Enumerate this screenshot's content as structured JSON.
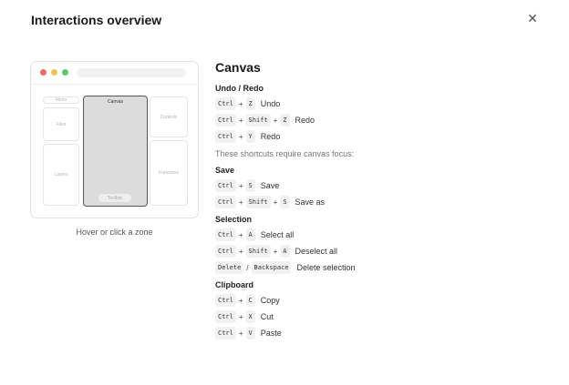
{
  "dialog": {
    "title": "Interactions overview",
    "close_icon": "close-icon"
  },
  "preview": {
    "zones": {
      "menu": "Menu",
      "files": "Files",
      "layers": "Layers",
      "canvas": "Canvas",
      "controls": "Controls",
      "functions": "Functions",
      "toolbar": "Toolbar"
    },
    "hint": "Hover or click a zone",
    "colors": {
      "red": "#ef6b6b",
      "yellow": "#f2c24f",
      "green": "#5ccb6b"
    }
  },
  "panel": {
    "title": "Canvas",
    "groups": [
      {
        "title": "Undo / Redo",
        "rows": [
          {
            "keys": [
              "Ctrl",
              "Z"
            ],
            "sep": "+",
            "action": "Undo"
          },
          {
            "keys": [
              "Ctrl",
              "Shift",
              "Z"
            ],
            "sep": "+",
            "action": "Redo"
          },
          {
            "keys": [
              "Ctrl",
              "Y"
            ],
            "sep": "+",
            "action": "Redo"
          }
        ],
        "note": "These shortcuts require canvas focus:"
      },
      {
        "title": "Save",
        "rows": [
          {
            "keys": [
              "Ctrl",
              "S"
            ],
            "sep": "+",
            "action": "Save"
          },
          {
            "keys": [
              "Ctrl",
              "Shift",
              "S"
            ],
            "sep": "+",
            "action": "Save as"
          }
        ]
      },
      {
        "title": "Selection",
        "rows": [
          {
            "keys": [
              "Ctrl",
              "A"
            ],
            "sep": "+",
            "action": "Select all"
          },
          {
            "keys": [
              "Ctrl",
              "Shift",
              "A"
            ],
            "sep": "+",
            "action": "Deselect all"
          },
          {
            "keys": [
              "Delete",
              "Backspace"
            ],
            "sep": "/",
            "action": "Delete selection"
          }
        ]
      },
      {
        "title": "Clipboard",
        "rows": [
          {
            "keys": [
              "Ctrl",
              "C"
            ],
            "sep": "+",
            "action": "Copy"
          },
          {
            "keys": [
              "Ctrl",
              "X"
            ],
            "sep": "+",
            "action": "Cut"
          },
          {
            "keys": [
              "Ctrl",
              "V"
            ],
            "sep": "+",
            "action": "Paste"
          }
        ]
      }
    ]
  }
}
